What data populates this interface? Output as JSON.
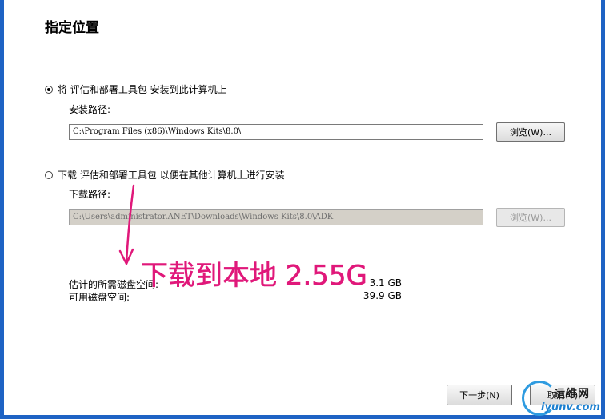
{
  "page": {
    "title": "指定位置"
  },
  "option_install": {
    "radio_label": "将 评估和部署工具包 安装到此计算机上",
    "selected": true,
    "path_label": "安装路径:",
    "path_value": "C:\\Program Files (x86)\\Windows Kits\\8.0\\",
    "browse_label": "浏览(W)..."
  },
  "option_download": {
    "radio_label": "下载 评估和部署工具包 以便在其他计算机上进行安装",
    "selected": false,
    "path_label": "下载路径:",
    "path_value": "C:\\Users\\administrator.ANET\\Downloads\\Windows Kits\\8.0\\ADK",
    "browse_label": "浏览(W)..."
  },
  "disk": {
    "required_label": "估计的所需磁盘空间:",
    "required_value": "3.1 GB",
    "available_label": "可用磁盘空间:",
    "available_value": "39.9 GB"
  },
  "annotation": {
    "handwritten_text": "下载到本地 2.55G",
    "color": "#e0187a"
  },
  "buttons": {
    "next_label": "下一步(N)",
    "cancel_label": "取消(C)"
  },
  "watermark": {
    "top_text": "运维网",
    "bottom_text": "iyunv.com"
  }
}
